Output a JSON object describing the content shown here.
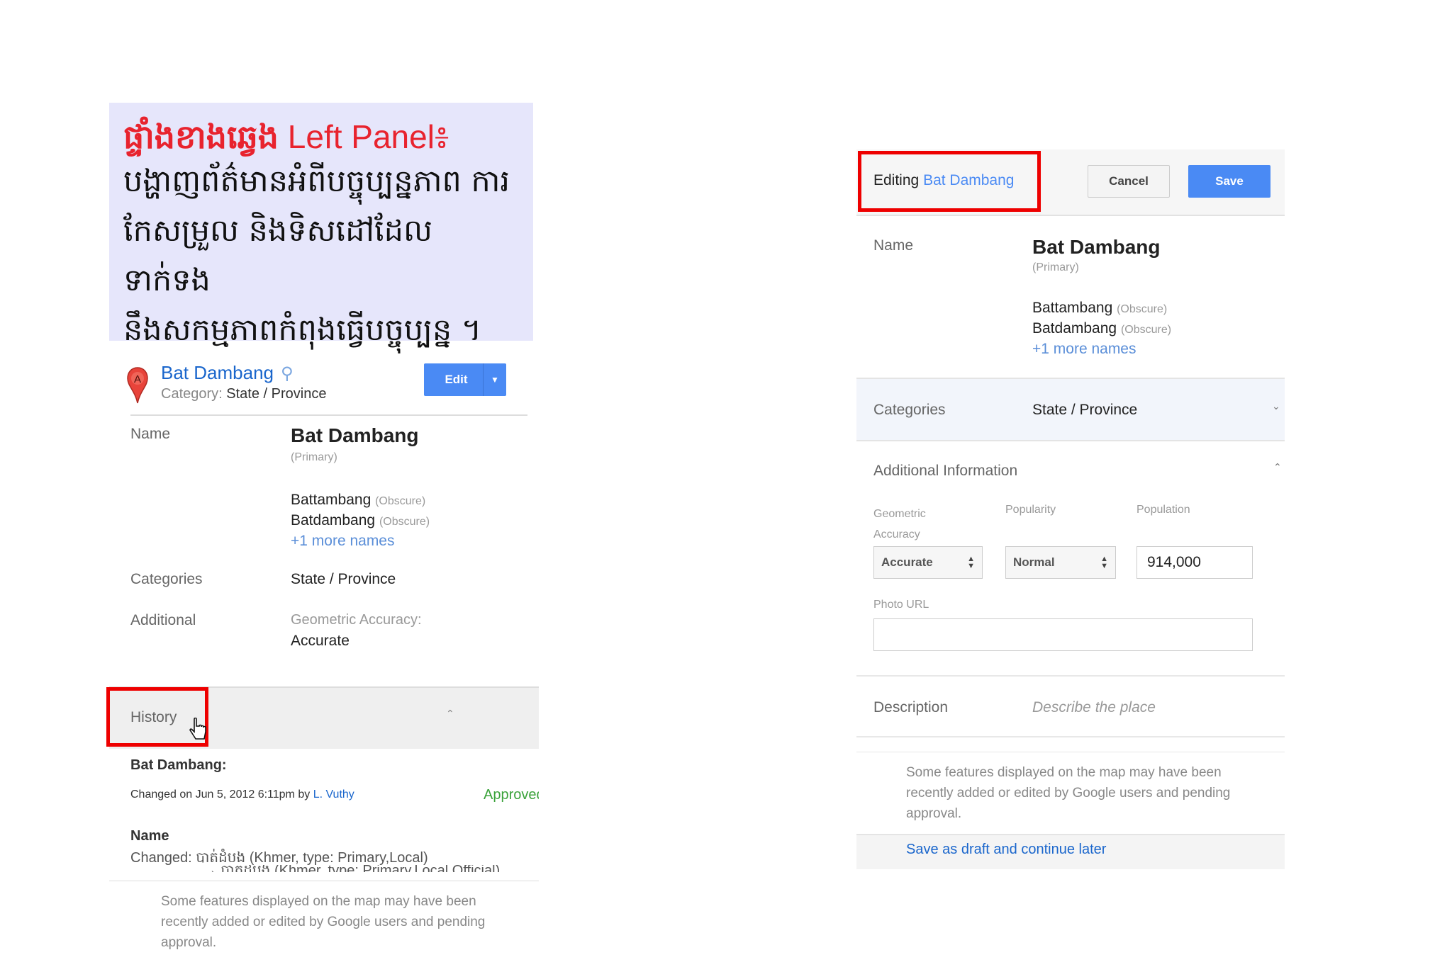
{
  "note": {
    "heading_khmer": "ផ្ទាំងខាងឆ្វេង",
    "heading_english": "Left Panel៖",
    "lines": [
      "បង្ហាញព័ត៌មានអំពីបច្ចុប្បន្នភាព ការ",
      "កែសម្រួល និងទិសដៅដែលទាក់ទង",
      "នឹងសកម្មភាពកំពុងធ្វើបច្ចុប្បន្ន ។"
    ]
  },
  "left": {
    "pin_letter": "A",
    "title": "Bat Dambang",
    "category_label": "Category:",
    "category_value": "State / Province",
    "edit_label": "Edit",
    "name_label": "Name",
    "primary_name": "Bat Dambang",
    "primary_tag": "(Primary)",
    "alt_names": [
      {
        "name": "Battambang",
        "tag": "(Obscure)"
      },
      {
        "name": "Batdambang",
        "tag": "(Obscure)"
      }
    ],
    "more_names": "+1 more names",
    "categories_label": "Categories",
    "categories_value": "State / Province",
    "additional_label": "Additional",
    "geo_accuracy_label": "Geometric Accuracy:",
    "geo_accuracy_value": "Accurate",
    "history_label": "History",
    "history_entity": "Bat Dambang:",
    "changed_on": "Changed on Jun 5, 2012 6:11pm by",
    "changed_by": "L. Vuthy",
    "status": "Approved",
    "change_name_label": "Name",
    "changed_prefix": "Changed:",
    "changed_from": "បាត់ដំបង (Khmer, type: Primary,Local)",
    "changed_to": "→ បាត់ដំបង (Khmer, type: Primary,Local,Official)",
    "footer": [
      "Some features displayed on the map may have been",
      "recently added or edited by Google users and pending",
      "approval."
    ]
  },
  "right": {
    "editing_prefix": "Editing",
    "editing_name": "Bat Dambang",
    "cancel_label": "Cancel",
    "save_label": "Save",
    "name_label": "Name",
    "primary_name": "Bat Dambang",
    "primary_tag": "(Primary)",
    "alt_names": [
      {
        "name": "Battambang",
        "tag": "(Obscure)"
      },
      {
        "name": "Batdambang",
        "tag": "(Obscure)"
      }
    ],
    "more_names": "+1 more names",
    "categories_label": "Categories",
    "categories_value": "State / Province",
    "additional_label": "Additional Information",
    "geo_label_1": "Geometric",
    "geo_label_2": "Accuracy",
    "popularity_label": "Popularity",
    "population_label": "Population",
    "geo_value": "Accurate",
    "popularity_value": "Normal",
    "population_value": "914,000",
    "photo_url_label": "Photo URL",
    "photo_url_value": "",
    "description_label": "Description",
    "description_placeholder": "Describe the place",
    "footer": [
      "Some features displayed on the map may have been",
      "recently added or edited by Google users and pending",
      "approval."
    ],
    "save_draft": "Save as draft and continue later"
  }
}
